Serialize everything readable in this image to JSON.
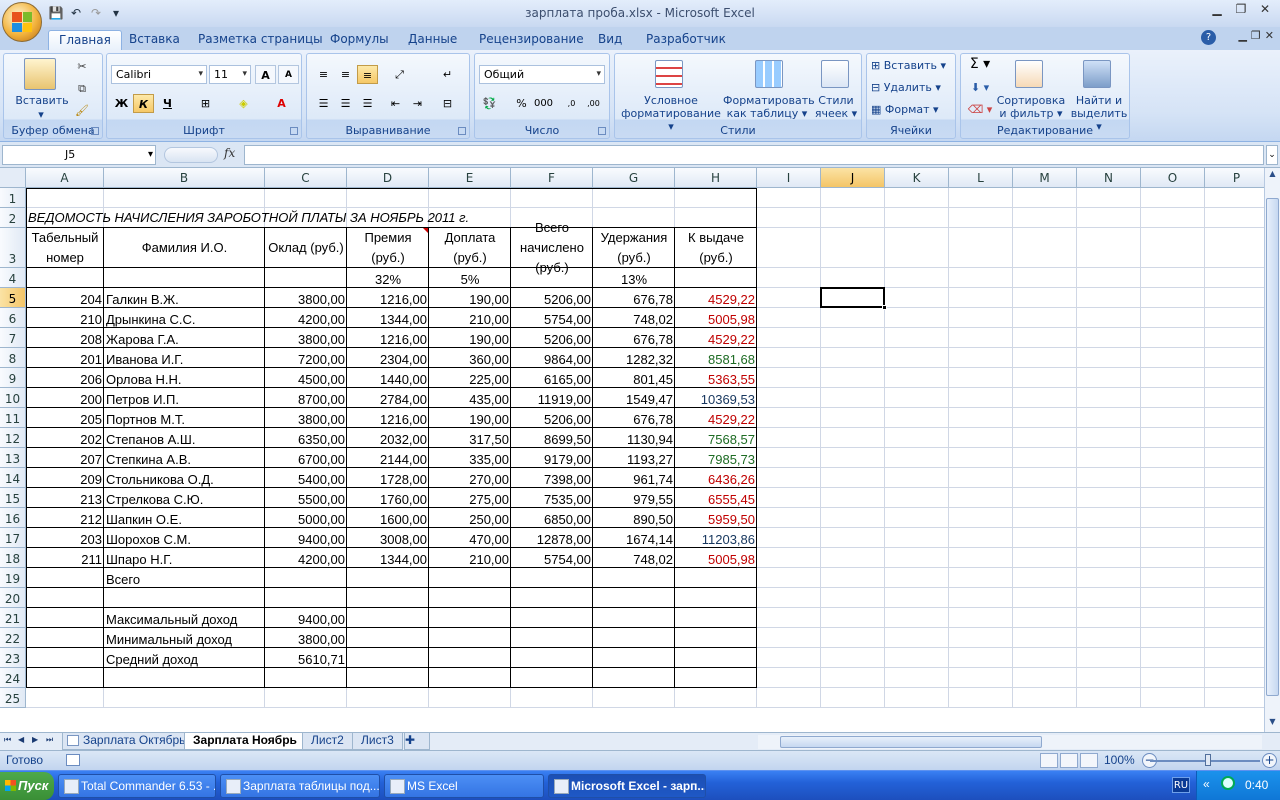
{
  "window": {
    "title": "зарплата проба.xlsx - Microsoft Excel"
  },
  "ribbon": {
    "tabs": [
      "Главная",
      "Вставка",
      "Разметка страницы",
      "Формулы",
      "Данные",
      "Рецензирование",
      "Вид",
      "Разработчик"
    ],
    "active_tab": "Главная",
    "clipboard": {
      "paste": "Вставить",
      "label": "Буфер обмена"
    },
    "font": {
      "name": "Calibri",
      "size": "11",
      "bold": "Ж",
      "italic": "К",
      "underline": "Ч",
      "label": "Шрифт"
    },
    "alignment": {
      "label": "Выравнивание"
    },
    "number": {
      "format": "Общий",
      "label": "Число"
    },
    "styles": {
      "cond1": "Условное",
      "cond2": "форматирование",
      "table1": "Форматировать",
      "table2": "как таблицу",
      "cell1": "Стили",
      "cell2": "ячеек",
      "label": "Стили"
    },
    "cells": {
      "insert": "Вставить",
      "delete": "Удалить",
      "format": "Формат",
      "label": "Ячейки"
    },
    "editing": {
      "sort1": "Сортировка",
      "sort2": "и фильтр",
      "find1": "Найти и",
      "find2": "выделить",
      "label": "Редактирование"
    }
  },
  "formula_bar": {
    "name_box": "J5",
    "fx": "fx",
    "value": ""
  },
  "columns": [
    "A",
    "B",
    "C",
    "D",
    "E",
    "F",
    "G",
    "H",
    "I",
    "J",
    "K",
    "L",
    "M",
    "N",
    "O",
    "P"
  ],
  "rows": [
    "1",
    "2",
    "3",
    "4",
    "5",
    "6",
    "7",
    "8",
    "9",
    "10",
    "11",
    "12",
    "13",
    "14",
    "15",
    "16",
    "17",
    "18",
    "19",
    "20",
    "21",
    "22",
    "23",
    "24",
    "25"
  ],
  "selected_cell": "J5",
  "sheet": {
    "title": "ВЕДОМОСТЬ НАЧИСЛЕНИЯ ЗАРОБОТНОЙ ПЛАТЫ        ЗА НОЯБРЬ 2011 г.",
    "headers": [
      "Табельный номер",
      "Фамилия И.О.",
      "Оклад (руб.)",
      "Премия (руб.)",
      "Доплата (руб.)",
      "Всего начислено (руб.)",
      "Удержания (руб.)",
      "К выдаче (руб.)"
    ],
    "rates": {
      "premium": "32%",
      "bonus": "5%",
      "deduction": "13%"
    },
    "employees": [
      {
        "id": "204",
        "name": "Галкин В.Ж.",
        "salary": "3800,00",
        "premium": "1216,00",
        "bonus": "190,00",
        "total": "5206,00",
        "deduct": "676,78",
        "payout": "4529,22",
        "color": "#c00000"
      },
      {
        "id": "210",
        "name": "Дрынкина С.С.",
        "salary": "4200,00",
        "premium": "1344,00",
        "bonus": "210,00",
        "total": "5754,00",
        "deduct": "748,02",
        "payout": "5005,98",
        "color": "#c00000"
      },
      {
        "id": "208",
        "name": "Жарова Г.А.",
        "salary": "3800,00",
        "premium": "1216,00",
        "bonus": "190,00",
        "total": "5206,00",
        "deduct": "676,78",
        "payout": "4529,22",
        "color": "#c00000"
      },
      {
        "id": "201",
        "name": "Иванова И.Г.",
        "salary": "7200,00",
        "premium": "2304,00",
        "bonus": "360,00",
        "total": "9864,00",
        "deduct": "1282,32",
        "payout": "8581,68",
        "color": "#1d6b23"
      },
      {
        "id": "206",
        "name": "Орлова Н.Н.",
        "salary": "4500,00",
        "premium": "1440,00",
        "bonus": "225,00",
        "total": "6165,00",
        "deduct": "801,45",
        "payout": "5363,55",
        "color": "#c00000"
      },
      {
        "id": "200",
        "name": "Петров И.П.",
        "salary": "8700,00",
        "premium": "2784,00",
        "bonus": "435,00",
        "total": "11919,00",
        "deduct": "1549,47",
        "payout": "10369,53",
        "color": "#17375e"
      },
      {
        "id": "205",
        "name": "Портнов М.Т.",
        "salary": "3800,00",
        "premium": "1216,00",
        "bonus": "190,00",
        "total": "5206,00",
        "deduct": "676,78",
        "payout": "4529,22",
        "color": "#c00000"
      },
      {
        "id": "202",
        "name": "Степанов А.Ш.",
        "salary": "6350,00",
        "premium": "2032,00",
        "bonus": "317,50",
        "total": "8699,50",
        "deduct": "1130,94",
        "payout": "7568,57",
        "color": "#1d6b23"
      },
      {
        "id": "207",
        "name": "Степкина А.В.",
        "salary": "6700,00",
        "premium": "2144,00",
        "bonus": "335,00",
        "total": "9179,00",
        "deduct": "1193,27",
        "payout": "7985,73",
        "color": "#1d6b23"
      },
      {
        "id": "209",
        "name": "Стольникова О.Д.",
        "salary": "5400,00",
        "premium": "1728,00",
        "bonus": "270,00",
        "total": "7398,00",
        "deduct": "961,74",
        "payout": "6436,26",
        "color": "#c00000"
      },
      {
        "id": "213",
        "name": "Стрелкова С.Ю.",
        "salary": "5500,00",
        "premium": "1760,00",
        "bonus": "275,00",
        "total": "7535,00",
        "deduct": "979,55",
        "payout": "6555,45",
        "color": "#c00000"
      },
      {
        "id": "212",
        "name": "Шапкин О.Е.",
        "salary": "5000,00",
        "premium": "1600,00",
        "bonus": "250,00",
        "total": "6850,00",
        "deduct": "890,50",
        "payout": "5959,50",
        "color": "#c00000"
      },
      {
        "id": "203",
        "name": "Шорохов С.М.",
        "salary": "9400,00",
        "premium": "3008,00",
        "bonus": "470,00",
        "total": "12878,00",
        "deduct": "1674,14",
        "payout": "11203,86",
        "color": "#17375e"
      },
      {
        "id": "211",
        "name": "Шпаро Н.Г.",
        "salary": "4200,00",
        "premium": "1344,00",
        "bonus": "210,00",
        "total": "5754,00",
        "deduct": "748,02",
        "payout": "5005,98",
        "color": "#c00000"
      }
    ],
    "total_label": "Всего",
    "summary": [
      {
        "label": "Максимальный доход",
        "value": "9400,00"
      },
      {
        "label": "Минимальный доход",
        "value": "3800,00"
      },
      {
        "label": "Средний доход",
        "value": "5610,71"
      }
    ]
  },
  "sheet_tabs": [
    "Зарплата Октябрь",
    "Зарплата Ноябрь",
    "Лист2",
    "Лист3"
  ],
  "active_sheet": "Зарплата Ноябрь",
  "status": {
    "ready": "Готово",
    "zoom": "100%"
  },
  "taskbar": {
    "start": "Пуск",
    "items": [
      "Total Commander 6.53 - ...",
      "Зарплата таблицы под...",
      "MS Excel",
      "Microsoft Excel - зарп..."
    ],
    "active": "Microsoft Excel - зарп...",
    "lang": "RU",
    "time": "0:40"
  }
}
